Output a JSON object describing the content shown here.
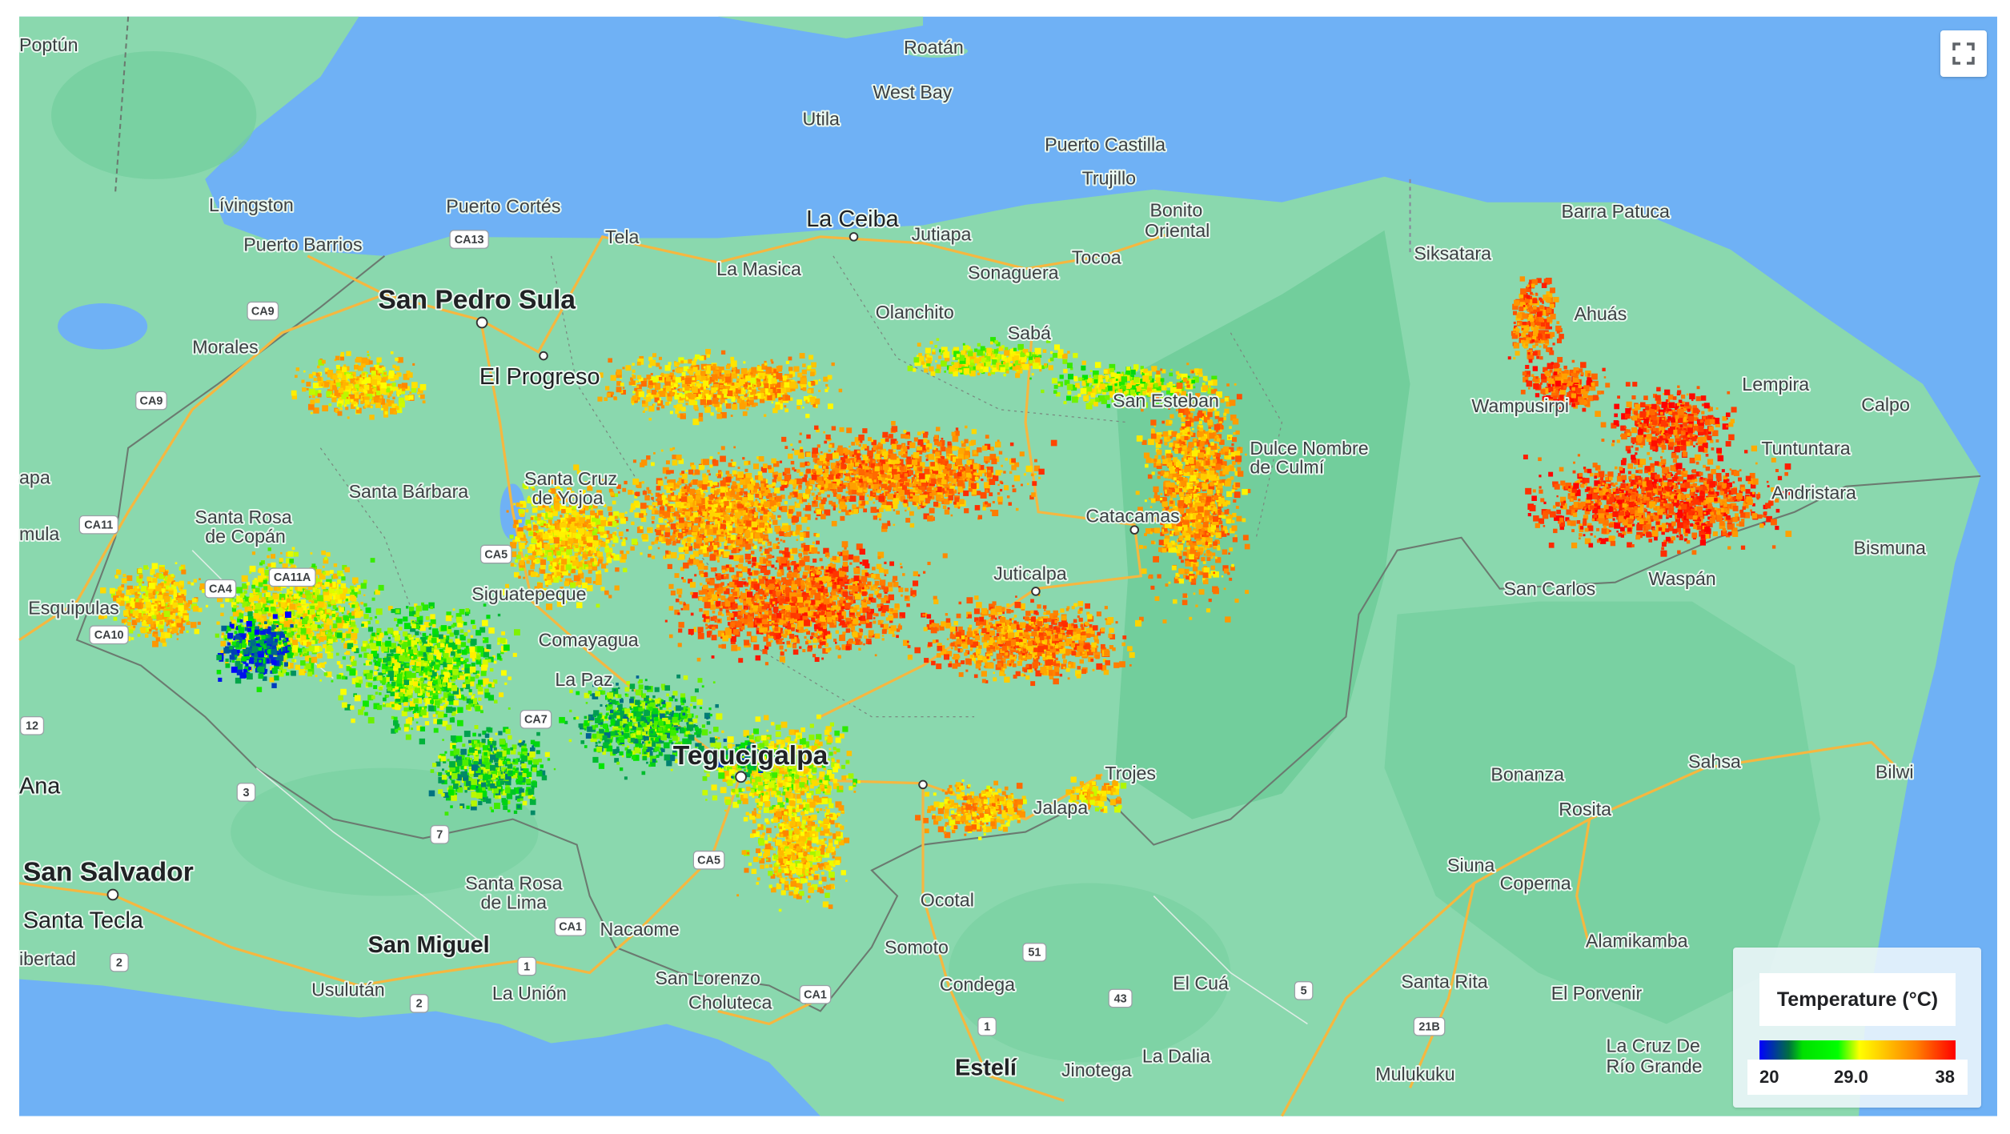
{
  "map": {
    "colors": {
      "sea": "#6fb1f5",
      "land": "#8ad8ae",
      "land_dark": "#72ce9c",
      "road": "#f5b740",
      "border": "#6b7a70"
    },
    "places": [
      "Poptún",
      "Roatán",
      "West Bay",
      "Utila",
      "Puerto Castilla",
      "Trujillo",
      "Lívingston",
      "Puerto Cortés",
      "La Ceiba",
      "Bonito",
      "Oriental",
      "Barra Patuca",
      "Puerto Barrios",
      "Tela",
      "Jutiapa",
      "Siksatara",
      "La Masica",
      "Sonaguera",
      "Tocoa",
      "San Pedro Sula",
      "Olanchito",
      "Ahuás",
      "Morales",
      "Sabá",
      "El Progreso",
      "Lempira",
      "San Esteban",
      "Wampusirpi",
      "Calpo",
      "Dulce Nombre",
      "de Culmí",
      "Tuntuntara",
      "Andristara",
      "Santa Bárbara",
      "Santa Cruz",
      "de Yojoa",
      "Catacamas",
      "Santa Rosa",
      "de Copán",
      "Bismuna",
      "Juticalpa",
      "San Carlos",
      "Waspán",
      "Esquipulas",
      "Siguatepeque",
      "Comayagua",
      "La Paz",
      "Tegucigalpa",
      "Trojes",
      "Bonanza",
      "Sahsa",
      "Bilwi",
      "Rosita",
      "Jalapa",
      "Ana",
      "San Salvador",
      "Santa Rosa",
      "de Lima",
      "Siuna",
      "Coperna",
      "Ocotal",
      "Santa Tecla",
      "Nacaome",
      "Alamikamba",
      "San Miguel",
      "Somoto",
      "Usulután",
      "La Unión",
      "San Lorenzo",
      "Choluteca",
      "Condega",
      "El Cuá",
      "Santa Rita",
      "El Porvenir",
      "Estelí",
      "Jinotega",
      "La Dalia",
      "Mulukuku",
      "La Cruz De",
      "Río Grande",
      "apa",
      "mula",
      "ibertad"
    ],
    "shields": [
      "CA13",
      "CA9",
      "CA9",
      "CA11",
      "CA4",
      "CA10",
      "CA11A",
      "CA5",
      "CA7",
      "CA5",
      "CA1",
      "3",
      "7",
      "2",
      "2",
      "1",
      "51",
      "43",
      "5",
      "21B",
      "1",
      "12",
      "CA1"
    ]
  },
  "controls": {
    "fullscreen_icon": "fullscreen-icon"
  },
  "legend": {
    "title": "Temperature (°C)",
    "min": "20",
    "mid": "29.0",
    "max": "38",
    "ramp": [
      "#0000ff",
      "#00ff00",
      "#ffff00",
      "#ff8000",
      "#ff0000"
    ]
  }
}
